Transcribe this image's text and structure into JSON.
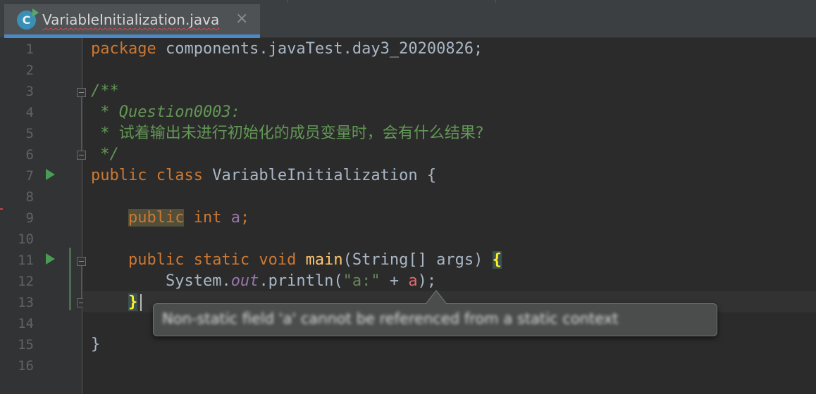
{
  "tab": {
    "title": "VariableInitialization.java",
    "icon_letter": "C",
    "close_glyph": "×"
  },
  "line_numbers": [
    "1",
    "2",
    "3",
    "4",
    "5",
    "6",
    "7",
    "8",
    "9",
    "10",
    "11",
    "12",
    "13",
    "14",
    "15",
    "16"
  ],
  "code": {
    "l1": {
      "kw": "package",
      "rest": " components.javaTest.day3_20200826;"
    },
    "l3": {
      "comment": "/**"
    },
    "l4": {
      "comment": " * Question0003:"
    },
    "l5": {
      "comment_star": " * ",
      "comment_text": "试着输出未进行初始化的成员变量时，会有什么结果?"
    },
    "l6": {
      "comment": " */"
    },
    "l7": {
      "kw": "public class",
      "rest": " VariableInitialization {"
    },
    "l9": {
      "indent": "    ",
      "kw_hl": "public",
      "kw2": " int",
      "space": " ",
      "field": "a",
      "end": ";"
    },
    "l11": {
      "indent": "    ",
      "kw": "public static void",
      "space": " ",
      "method": "main",
      "params": "(String[] args) ",
      "brace": "{"
    },
    "l12": {
      "indent": "        ",
      "sys": "System.",
      "out": "out",
      "call": ".println(",
      "str": "\"a:\"",
      "plus": " + ",
      "err_var": "a",
      "end": ");"
    },
    "l13": {
      "indent": "    ",
      "brace": "}"
    },
    "l15": {
      "brace": "}"
    }
  },
  "tooltip": {
    "text": "Non-static field 'a' cannot be referenced from a static context"
  },
  "colors": {
    "background": "#2b2b2b",
    "keyword": "#cc7832",
    "comment": "#629755",
    "field": "#9876aa",
    "method": "#ffc66d",
    "string": "#6a8759",
    "error": "#e06c6c",
    "tab_underline": "#4a88c7"
  }
}
